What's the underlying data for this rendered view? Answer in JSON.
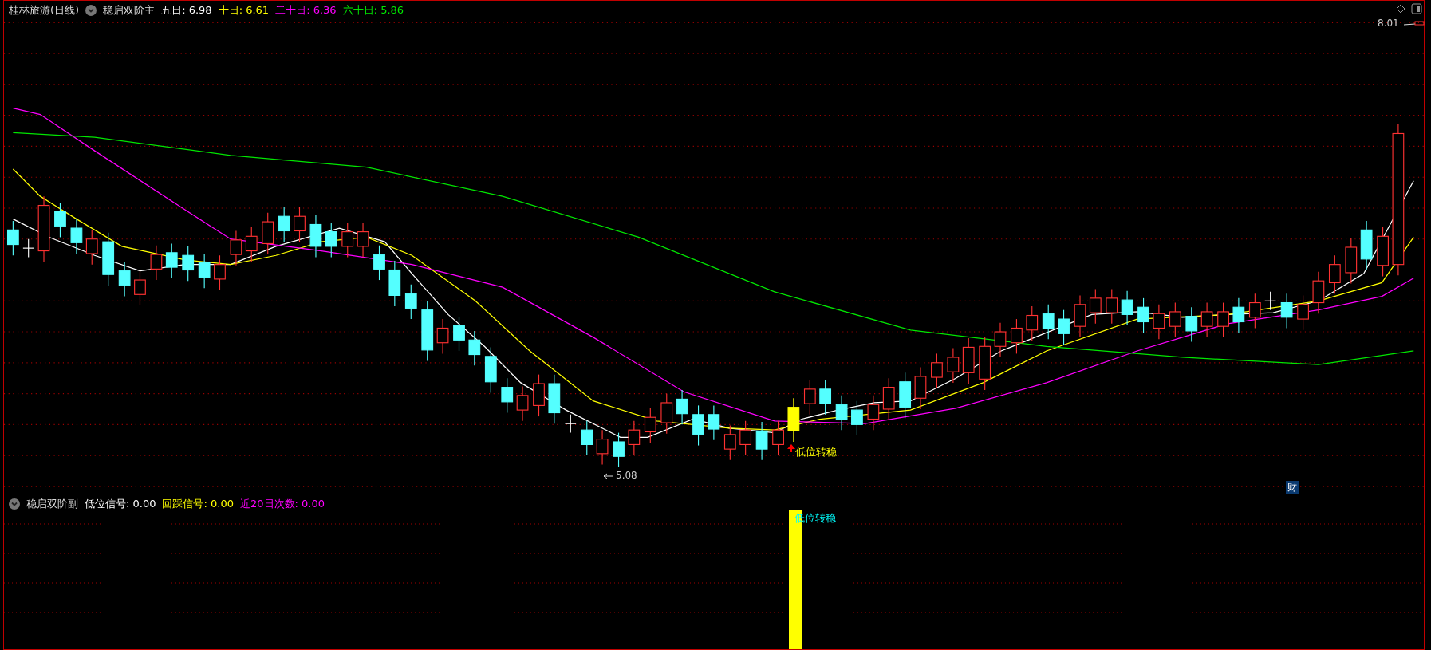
{
  "main_panel": {
    "stock": "桂林旅游(日线)",
    "indicator": "稳启双阶主",
    "readings": [
      {
        "label": "五日:",
        "value": "6.98",
        "color": "#ffffff"
      },
      {
        "label": "十日:",
        "value": "6.61",
        "color": "#ffff00"
      },
      {
        "label": "二十日:",
        "value": "6.36",
        "color": "#ff00ff"
      },
      {
        "label": "六十日:",
        "value": "5.86",
        "color": "#00e600"
      }
    ],
    "high_label": "8.01",
    "low_label": "5.08",
    "signal_label": "低位转稳",
    "finance_badge": "财"
  },
  "sub_panel": {
    "indicator": "稳启双阶副",
    "readings": [
      {
        "label": "低位信号:",
        "value": "0.00",
        "color": "#ffffff"
      },
      {
        "label": "回踩信号:",
        "value": "0.00",
        "color": "#ffff00"
      },
      {
        "label": "近20日次数:",
        "value": "0.00",
        "color": "#ff00ff"
      }
    ],
    "signal_label": "低位转稳"
  }
}
